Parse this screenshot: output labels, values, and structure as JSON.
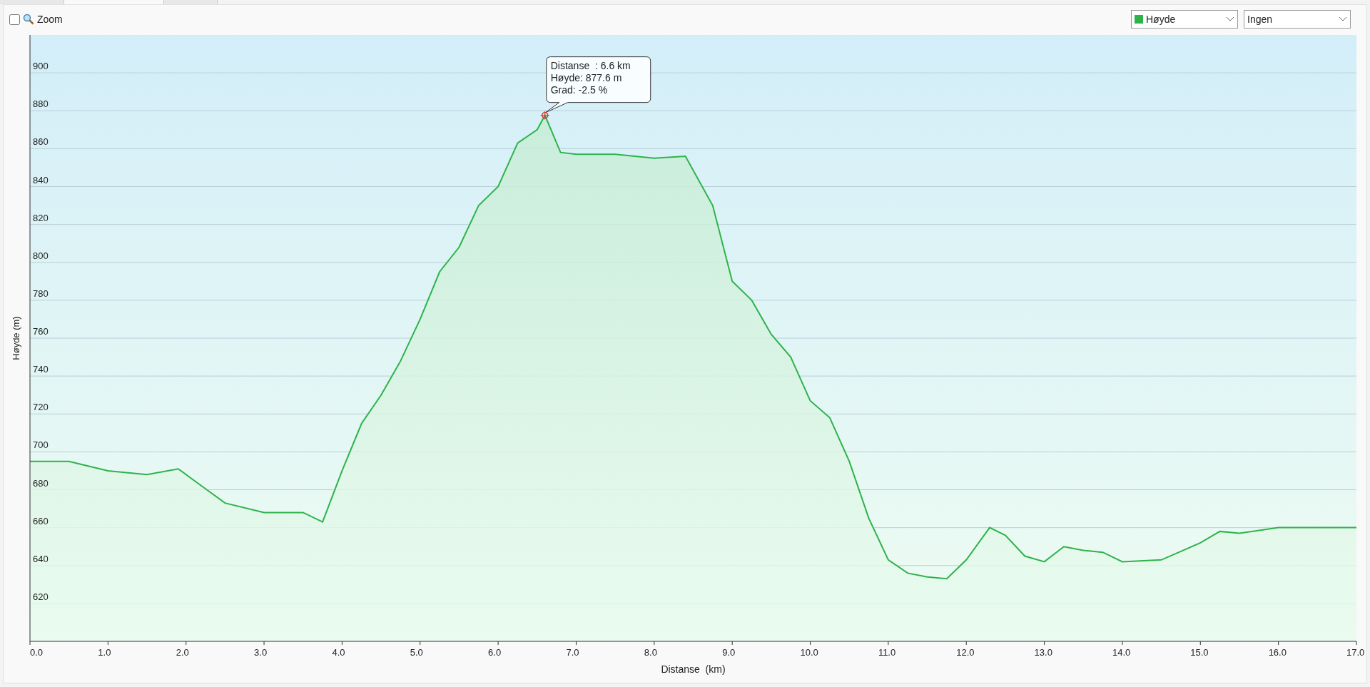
{
  "tabs": [
    {
      "selected": false
    },
    {
      "selected": true
    },
    {
      "selected": false
    }
  ],
  "toolbar": {
    "zoom": {
      "label": "Zoom",
      "checked": false
    },
    "second_select": {
      "value": "Ingen"
    }
  },
  "chart": {
    "tooltip": {
      "lines": [
        "Distanse  : 6.6 km",
        "Høyde: 877.6 m",
        "Grad: -2.5 %"
      ]
    },
    "chart_data": {
      "type": "area",
      "grid": true,
      "xlabel": "Distanse  (km)",
      "ylabel": "Høyde (m)",
      "xlim": [
        0,
        17
      ],
      "ylim": [
        600,
        920
      ],
      "xticks": [
        {
          "value": 0,
          "label": "0.0"
        },
        {
          "value": 1,
          "label": "1.0"
        },
        {
          "value": 2,
          "label": "2.0"
        },
        {
          "value": 3,
          "label": "3.0"
        },
        {
          "value": 4,
          "label": "4.0"
        },
        {
          "value": 5,
          "label": "5.0"
        },
        {
          "value": 6,
          "label": "6.0"
        },
        {
          "value": 7,
          "label": "7.0"
        },
        {
          "value": 8,
          "label": "8.0"
        },
        {
          "value": 9,
          "label": "9.0"
        },
        {
          "value": 10,
          "label": "10.0"
        },
        {
          "value": 11,
          "label": "11.0"
        },
        {
          "value": 12,
          "label": "12.0"
        },
        {
          "value": 13,
          "label": "13.0"
        },
        {
          "value": 14,
          "label": "14.0"
        },
        {
          "value": 15,
          "label": "15.0"
        },
        {
          "value": 16,
          "label": "16.0"
        },
        {
          "value": 17,
          "label": "17.0"
        }
      ],
      "yticks": [
        620,
        640,
        660,
        680,
        700,
        720,
        740,
        760,
        780,
        800,
        820,
        840,
        860,
        880,
        900
      ],
      "x": [
        0,
        0.5,
        1,
        1.5,
        1.9,
        2.2,
        2.5,
        3,
        3.5,
        3.75,
        4,
        4.25,
        4.5,
        4.75,
        5,
        5.25,
        5.5,
        5.75,
        6,
        6.25,
        6.5,
        6.6,
        6.8,
        7,
        7.5,
        8,
        8.4,
        8.75,
        9,
        9.25,
        9.5,
        9.75,
        10,
        10.25,
        10.5,
        10.75,
        11,
        11.25,
        11.5,
        11.75,
        12,
        12.3,
        12.5,
        12.75,
        13,
        13.25,
        13.5,
        13.75,
        14,
        14.5,
        15,
        15.25,
        15.5,
        16,
        16.5,
        17
      ],
      "series": [
        {
          "name": "Høyde",
          "color": "#2db34a",
          "values": [
            695,
            695,
            690,
            688,
            691,
            682,
            673,
            668,
            668,
            663,
            690,
            715,
            730,
            748,
            770,
            795,
            808,
            830,
            840,
            863,
            870,
            877.6,
            858,
            857,
            857,
            855,
            856,
            830,
            790,
            780,
            762,
            750,
            727,
            718,
            695,
            665,
            643,
            636,
            634,
            633,
            643,
            660,
            656,
            645,
            642,
            650,
            648,
            647,
            642,
            643,
            652,
            658,
            657,
            660,
            660,
            660
          ]
        }
      ]
    }
  }
}
